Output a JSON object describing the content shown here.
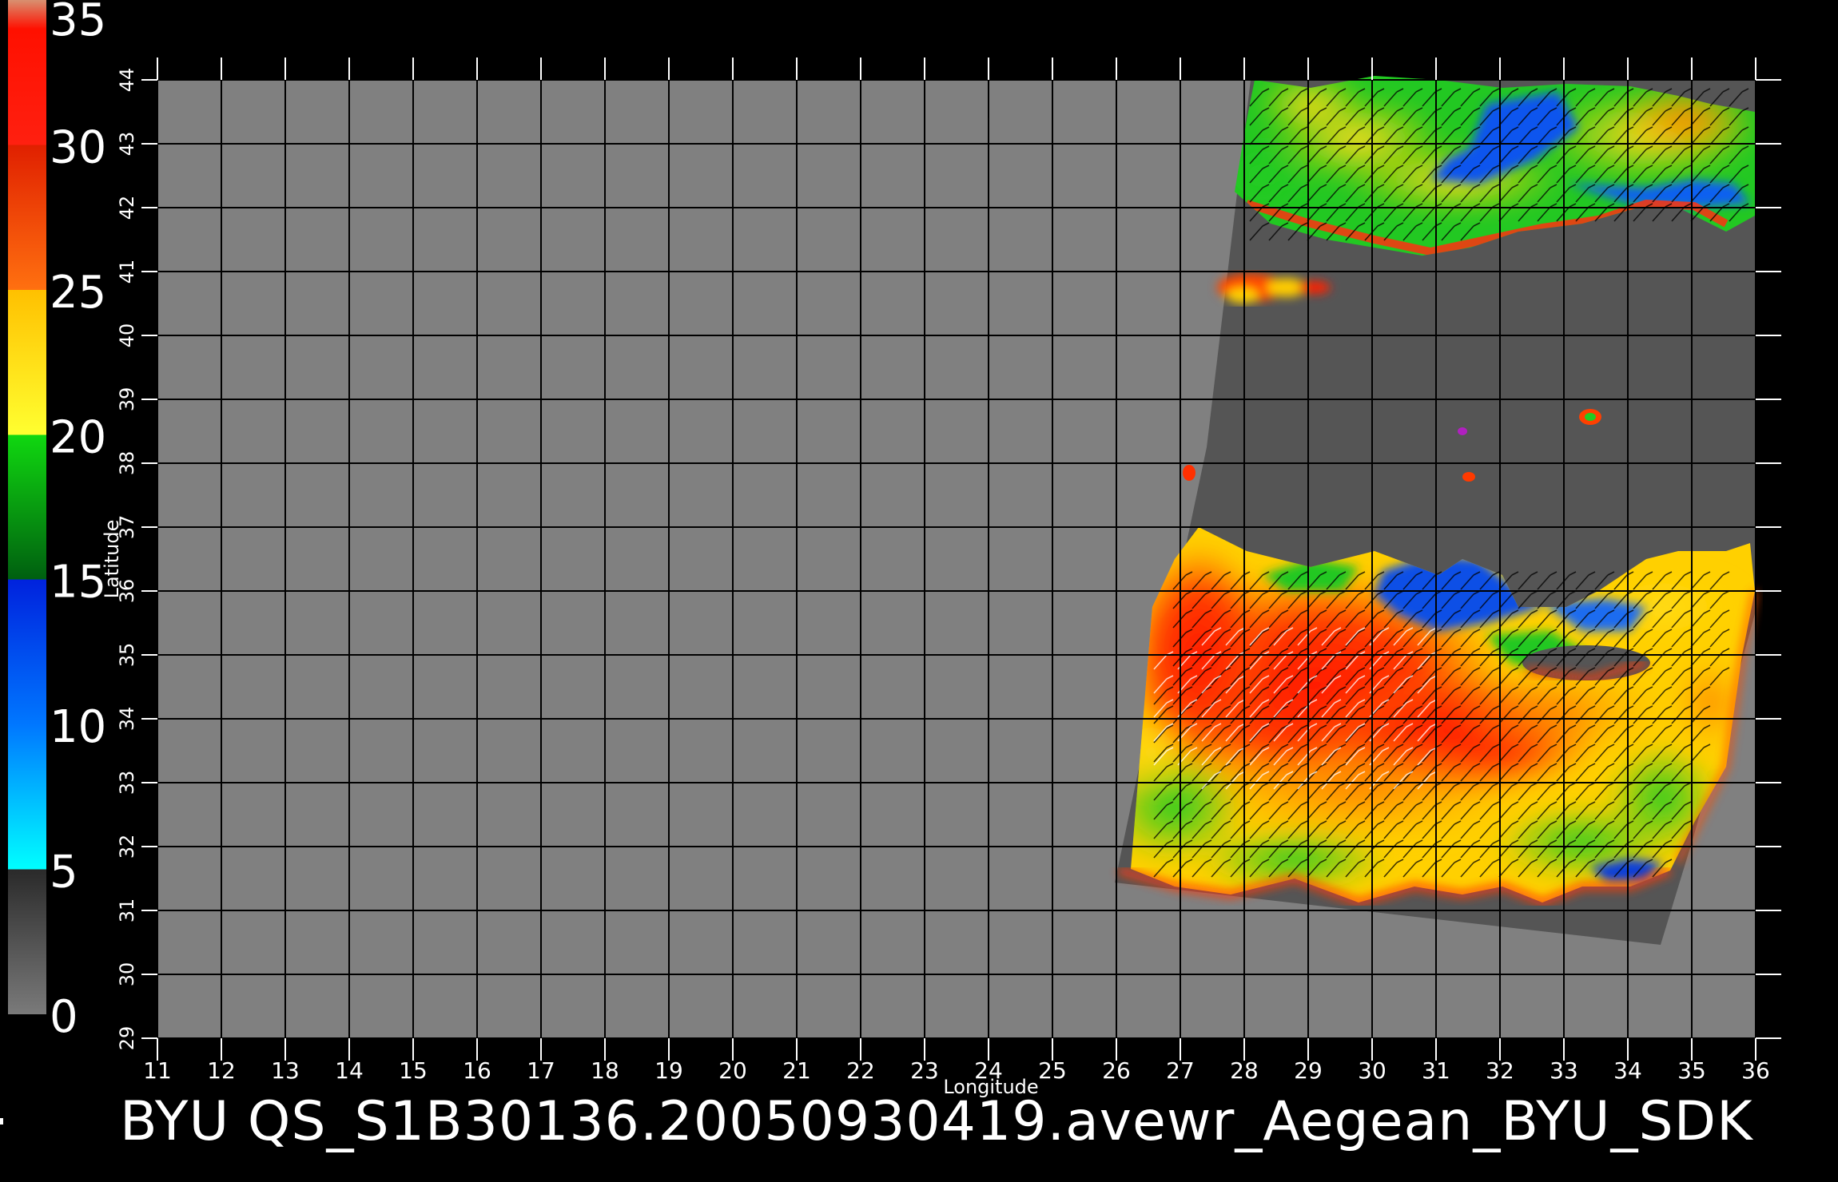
{
  "caption": "BYU  QS_S1B30136.20050930419.avewr_Aegean_BYU_SDK",
  "axes": {
    "xlabel": "Longitude",
    "ylabel": "Latitude",
    "lon_ticks": [
      11,
      12,
      13,
      14,
      15,
      16,
      17,
      18,
      19,
      20,
      21,
      22,
      23,
      24,
      25,
      26,
      27,
      28,
      29,
      30,
      31,
      32,
      33,
      34,
      35,
      36
    ],
    "lat_ticks": [
      29,
      30,
      31,
      32,
      33,
      34,
      35,
      36,
      37,
      38,
      39,
      40,
      41,
      42,
      43,
      44
    ],
    "lon_range": [
      11,
      36
    ],
    "lat_range": [
      29,
      44
    ]
  },
  "colorbar": {
    "labels": [
      "0",
      "5",
      "10",
      "15",
      "20",
      "25",
      "30",
      "35"
    ],
    "range": [
      0,
      35
    ],
    "stops": [
      {
        "value": 0,
        "color": "#7a7a7a"
      },
      {
        "value": 5,
        "color": "#2a2a2a"
      },
      {
        "value": 5,
        "color": "#00ffff"
      },
      {
        "value": 10,
        "color": "#0077ff"
      },
      {
        "value": 15,
        "color": "#0022dd"
      },
      {
        "value": 15,
        "color": "#005f10"
      },
      {
        "value": 20,
        "color": "#10d810"
      },
      {
        "value": 20,
        "color": "#ffff30"
      },
      {
        "value": 25,
        "color": "#ffc000"
      },
      {
        "value": 25,
        "color": "#ff7010"
      },
      {
        "value": 30,
        "color": "#e02000"
      },
      {
        "value": 30,
        "color": "#ff2010"
      },
      {
        "value": 34,
        "color": "#ff1000"
      },
      {
        "value": 35,
        "color": "#d89070"
      }
    ]
  },
  "colors": {
    "background": "#000000",
    "land": "#808080",
    "swath": "#555555",
    "grid": "#000000",
    "text": "#ffffff"
  }
}
